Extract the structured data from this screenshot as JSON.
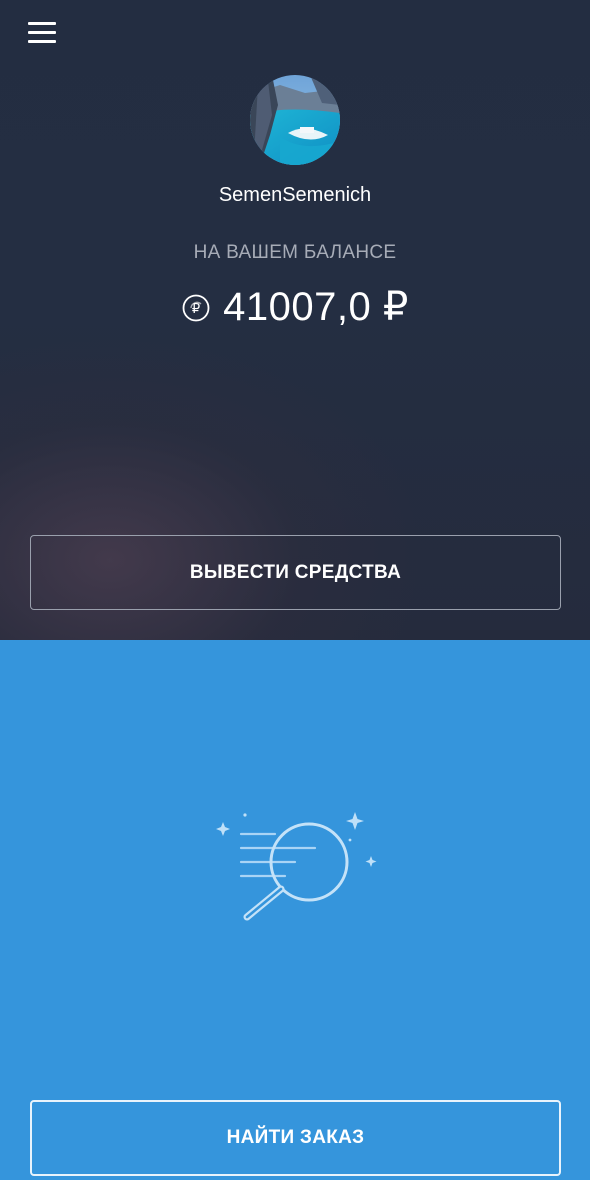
{
  "header": {
    "menu_icon": "hamburger-menu-icon"
  },
  "profile": {
    "avatar_icon": "profile-photo-seaside-cliffs",
    "username": "SemenSemenich"
  },
  "balance": {
    "label": "НА ВАШЕМ БАЛАНСЕ",
    "icon": "ruble-coin-icon",
    "amount": "41007,0 ₽"
  },
  "actions": {
    "withdraw_label": "ВЫВЕСТИ СРЕДСТВА",
    "find_order_label": "НАЙТИ ЗАКАЗ"
  },
  "illustration": {
    "icon": "search-magnifier-icon"
  },
  "colors": {
    "top_background": "#242e42",
    "bottom_background": "#3595dc",
    "text_primary": "#ffffff",
    "text_muted": "#a7acb7"
  }
}
